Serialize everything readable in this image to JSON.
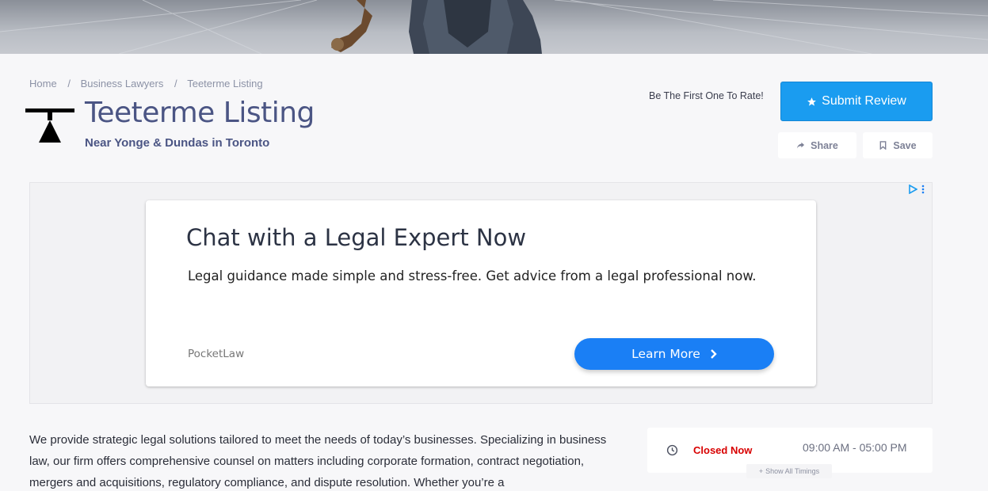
{
  "breadcrumb": {
    "home": "Home",
    "category": "Business Lawyers",
    "current": "Teeterme Listing",
    "separator": "/"
  },
  "listing": {
    "title": "Teeterme Listing",
    "location": "Near Yonge & Dundas in Toronto"
  },
  "actions": {
    "rate_prompt": "Be The First One To Rate!",
    "submit_review": "Submit Review",
    "share": "Share",
    "save": "Save"
  },
  "ad": {
    "headline": "Chat with a Legal Expert Now",
    "body": "Legal guidance made simple and stress-free. Get advice from a legal professional now.",
    "brand": "PocketLaw",
    "cta": "Learn More"
  },
  "description": "We provide strategic legal solutions tailored to meet the needs of today’s businesses. Specializing in business law, our firm offers comprehensive counsel on matters including corporate formation, contract negotiation, mergers and acquisitions, regulatory compliance, and dispute resolution. Whether you’re a",
  "hours": {
    "status": "Closed Now",
    "timing": "09:00 AM - 05:00 PM",
    "show_all": "Show All Timings"
  },
  "colors": {
    "accent": "#1a9cf0",
    "title": "#4b5584",
    "closed": "#d80000",
    "ad_cta": "#1a7ff5"
  }
}
